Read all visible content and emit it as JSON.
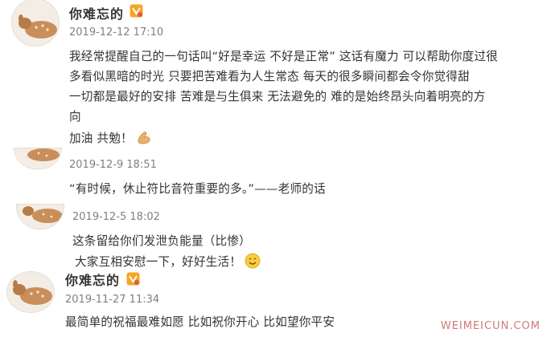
{
  "comments": [
    {
      "username": "你难忘的",
      "timestamp": "2019-12-12 17:10",
      "lines": [
        "我经常提醒自己的一句话叫“好是幸运 不好是正常” 这话有魔力 可以帮助你度过很",
        "多看似黑暗的时光 只要把苦难看为人生常态 每天的很多瞬间都会令你觉得甜",
        "一切都是最好的安排 苦难是与生俱来 无法避免的 难的是始终昂头向着明亮的方",
        "向",
        "加油 共勉！"
      ],
      "emoji": "flexed-biceps-emoji"
    },
    {
      "timestamp": "2019-12-9 18:51",
      "lines": [
        "“有时候，休止符比音符重要的多。”——老师的话"
      ]
    },
    {
      "timestamp": "2019-12-5 18:02",
      "lines": [
        "这条留给你们发泄负能量（比惨）",
        "大家互相安慰一下，好好生活！"
      ],
      "emoji": "smile-emoji"
    },
    {
      "username": "你难忘的",
      "timestamp": "2019-11-27 11:34",
      "lines": [
        "最简单的祝福最难如愿 比如祝你开心 比如望你平安"
      ]
    }
  ],
  "icons": {
    "vip": "vip-badge-icon",
    "avatar": "deer-avatar"
  },
  "watermark": "WEIMEICUN.COM",
  "colors": {
    "text": "#333333",
    "timestamp": "#808080",
    "vip_badge": "#f5a623",
    "watermark": "#d07a74"
  }
}
